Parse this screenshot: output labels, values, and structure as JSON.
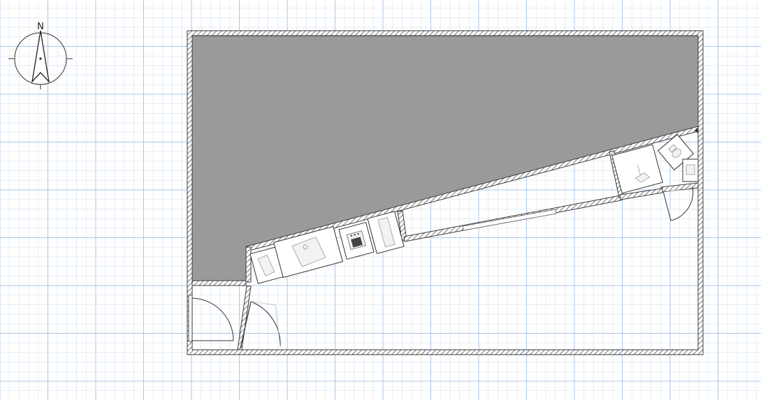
{
  "compass": {
    "north_label": "N"
  },
  "colors": {
    "grid_minor": "#d9e6f4",
    "grid_major": "#a9c7e8",
    "wall_fill": "#ffffff",
    "wall_stroke": "#3a3a3a",
    "wall_hatch": "#555555",
    "room_fill": "#9a9a9a",
    "furniture_fill": "#ffffff",
    "furniture_stroke": "#333333"
  },
  "furniture": [
    {
      "name": "cabinet-icon"
    },
    {
      "name": "sink-cabinet-icon"
    },
    {
      "name": "stove-icon"
    },
    {
      "name": "fridge-icon"
    },
    {
      "name": "washbasin-icon"
    },
    {
      "name": "toilet-icon"
    },
    {
      "name": "shower-icon"
    }
  ],
  "doors": [
    {
      "name": "entrance-door"
    },
    {
      "name": "kitchen-door"
    },
    {
      "name": "bathroom-door"
    }
  ]
}
